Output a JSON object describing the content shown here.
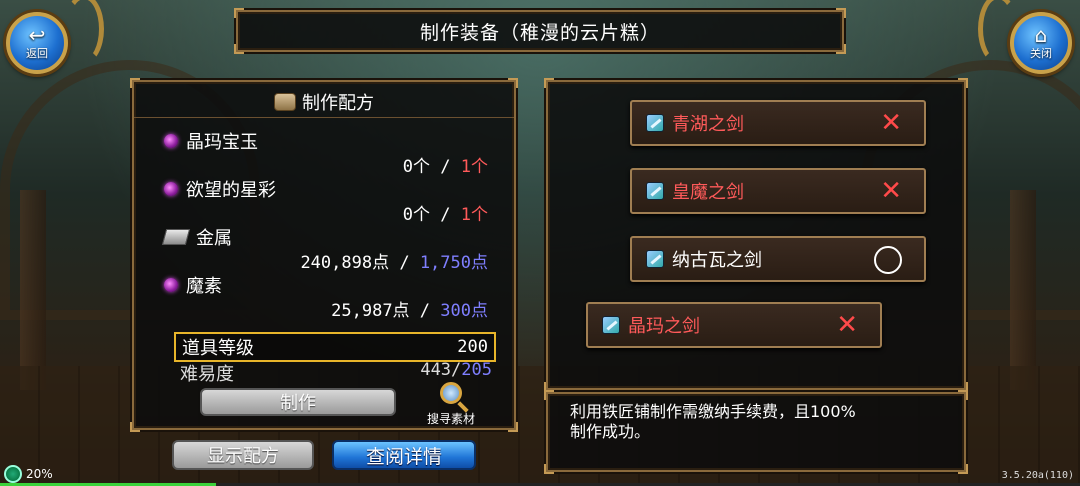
{
  "header": {
    "title": "制作装备（稚漫的云片糕）"
  },
  "nav": {
    "back_label": "返回",
    "back_glyph": "↩",
    "close_label": "关闭",
    "close_glyph": "⌂"
  },
  "recipe_panel": {
    "title": "制作配方",
    "materials": [
      {
        "name": "晶玛宝玉",
        "icon": "purple-orb-icon",
        "have": "0个",
        "sep": " / ",
        "need": "1个",
        "need_color": "red"
      },
      {
        "name": "欲望的星彩",
        "icon": "purple-orb-icon",
        "have": "0个",
        "sep": " / ",
        "need": "1个",
        "need_color": "red"
      },
      {
        "name": "金属",
        "icon": "ingot-icon",
        "have": "240,898点",
        "sep": " / ",
        "need": "1,750点",
        "need_color": "blue"
      },
      {
        "name": "魔素",
        "icon": "purple-orb-icon",
        "have": "25,987点",
        "sep": " / ",
        "need": "300点",
        "need_color": "blue"
      }
    ],
    "item_level_label": "道具等级",
    "item_level_value": "200",
    "difficulty_label": "难易度",
    "difficulty_have": "443/",
    "difficulty_need": "205",
    "craft_button": "制作",
    "search_label": "搜寻素材"
  },
  "bottom_buttons": {
    "show_recipe": "显示配方",
    "view_details": "查阅详情"
  },
  "recipe_list": [
    {
      "name": "青湖之剑",
      "mark": "✕",
      "mark_type": "x"
    },
    {
      "name": "皇魔之剑",
      "mark": "✕",
      "mark_type": "x"
    },
    {
      "name": "纳古瓦之剑",
      "mark": "",
      "mark_type": "o"
    },
    {
      "name": "晶玛之剑",
      "mark": "✕",
      "mark_type": "x"
    }
  ],
  "description": {
    "line1": "利用铁匠铺制作需缴纳手续费，且100%",
    "line2": "制作成功。"
  },
  "status": {
    "percent": "20%",
    "exp_fill": 0.2,
    "version": "3.5.20a(110)"
  },
  "colors": {
    "red": "#ff5a5a",
    "blue": "#7f7fff",
    "gold": "#e8b52a"
  }
}
